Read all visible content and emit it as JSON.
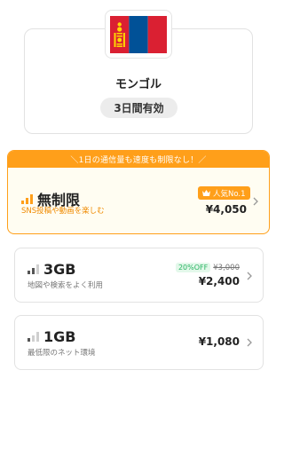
{
  "country": {
    "name": "モンゴル",
    "validity": "3日間有効",
    "flag_icon": "mongolia-flag-icon",
    "flag_colors": {
      "red": "#da2032",
      "blue": "#015197",
      "emblem": "#ffd900"
    }
  },
  "featured_plan": {
    "banner": "＼1日の通信量も速度も制限なし！／",
    "name": "無制限",
    "description": "SNS投稿や動画を楽しむ",
    "badge": "人気No.1",
    "price": "¥4,050",
    "signal_level": 3
  },
  "plans": [
    {
      "name": "3GB",
      "description": "地図や検索をよく利用",
      "discount": "20%OFF",
      "original_price": "¥3,000",
      "price": "¥2,400",
      "signal_level": 2
    },
    {
      "name": "1GB",
      "description": "最低限のネット環境",
      "price": "¥1,080",
      "signal_level": 1
    }
  ],
  "colors": {
    "accent": "#ff9f1a",
    "discount_text": "#27b361",
    "discount_bg": "#e3f8ea"
  },
  "icons": {
    "signal": "signal-bars-icon",
    "crown": "crown-icon",
    "chevron": "chevron-right-icon"
  }
}
